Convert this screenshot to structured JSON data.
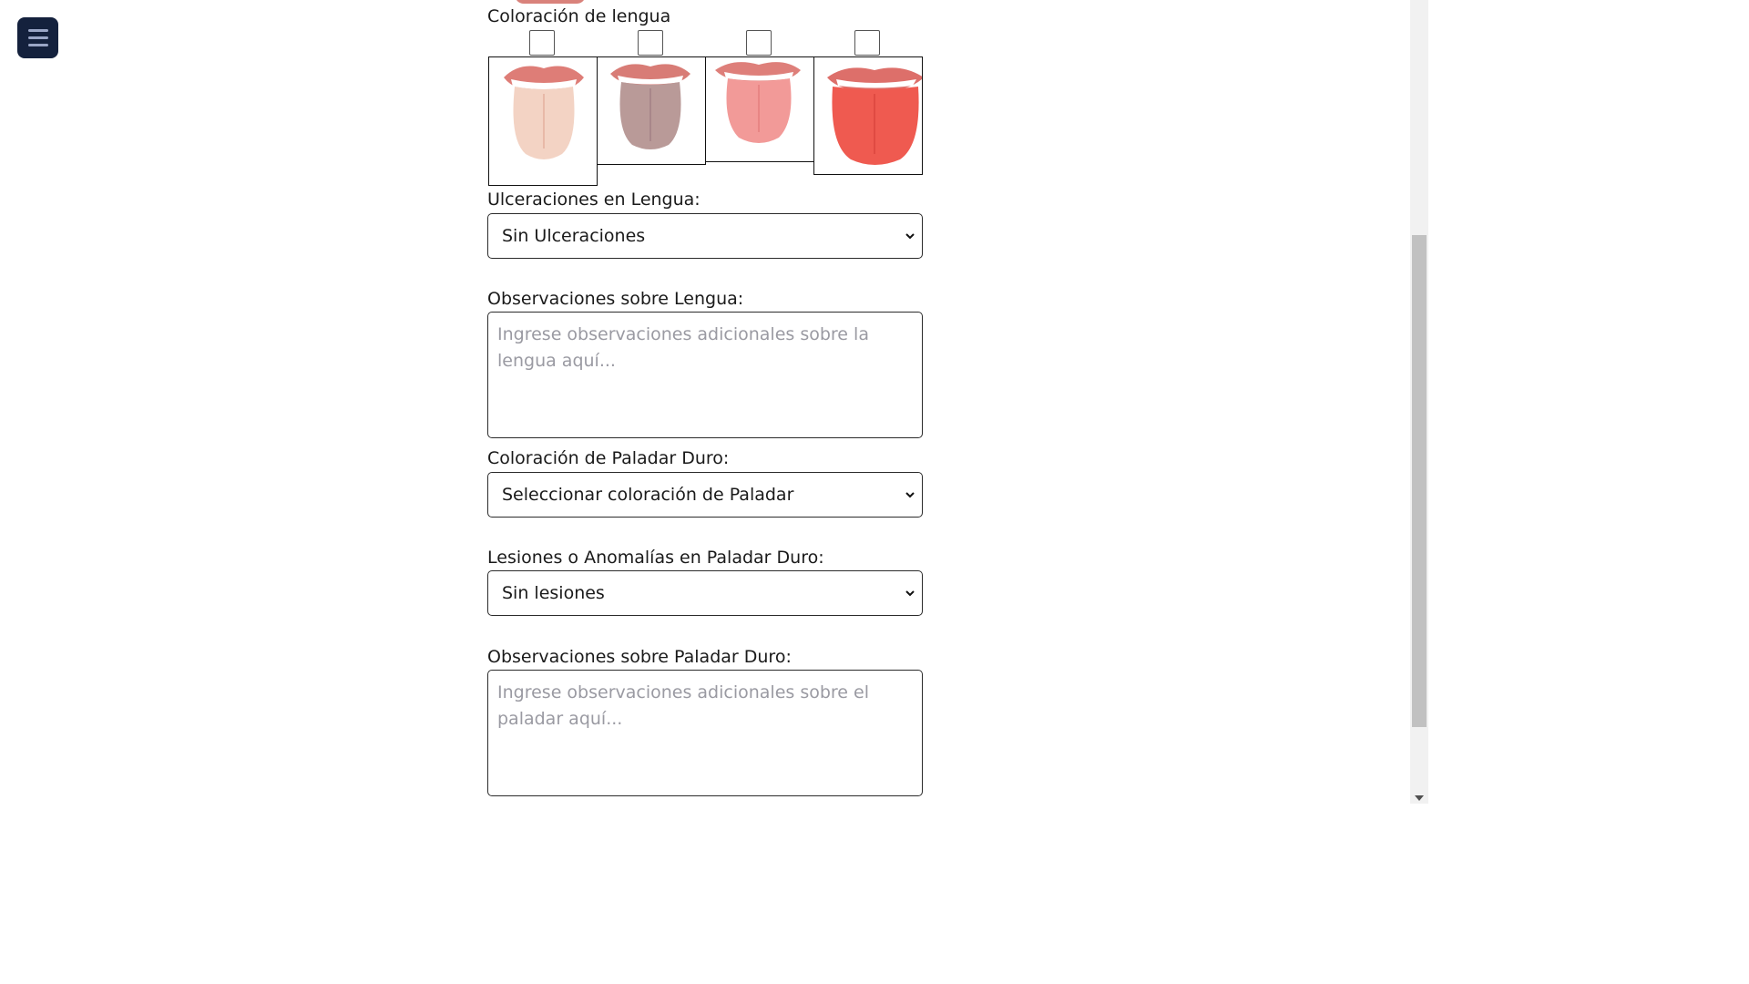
{
  "menu": {
    "icon": "hamburger-menu-icon"
  },
  "tongue_color": {
    "label": "Coloración de lengua",
    "options": [
      {
        "checked": false,
        "image": "pale-tongue-image",
        "color": "#f3d3c4"
      },
      {
        "checked": false,
        "image": "grey-tongue-image",
        "color": "#b99a98"
      },
      {
        "checked": false,
        "image": "pink-tongue-image",
        "color": "#f29a98"
      },
      {
        "checked": false,
        "image": "red-tongue-image",
        "color": "#ef5a50"
      }
    ]
  },
  "ulcerations": {
    "label": "Ulceraciones en Lengua:",
    "value": "Sin Ulceraciones"
  },
  "tongue_notes": {
    "label": "Observaciones sobre Lengua:",
    "placeholder": "Ingrese observaciones adicionales sobre la lengua aquí..."
  },
  "palate_color": {
    "label": "Coloración de Paladar Duro:",
    "value": "Seleccionar coloración de Paladar"
  },
  "palate_lesions": {
    "label": "Lesiones o Anomalías en Paladar Duro:",
    "value": "Sin lesiones"
  },
  "palate_notes": {
    "label": "Observaciones sobre Paladar Duro:",
    "placeholder": "Ingrese observaciones adicionales sobre el paladar aquí..."
  }
}
